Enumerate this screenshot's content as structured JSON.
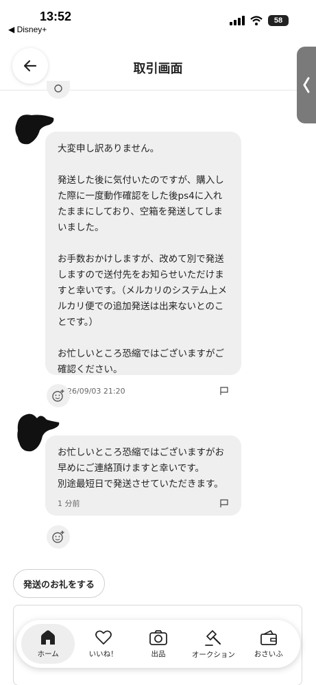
{
  "status_bar": {
    "time": "13:52",
    "back_app": "◀ Disney+",
    "battery": "58"
  },
  "header": {
    "title": "取引画面"
  },
  "messages": [
    {
      "text": "大変申し訳ありません。\n\n発送した後に気付いたのですが、購入した際に一度動作確認をした後ps4に入れたままにしており、空箱を発送してしまいました。\n\nお手数おかけしますが、改めて別で発送しますので送付先をお知らせいただけますと幸いです。（メルカリのシステム上メルカリ便での追加発送は出来ないとのことです。）\n\nお忙しいところ恐縮ではございますがご確認ください。",
      "timestamp": "2026/09/03 21:20"
    },
    {
      "text": "お忙しいところ恐縮ではございますがお早めにご連絡頂けますと幸いです。\n別途最短日で発送させていただきます。",
      "timestamp": "1 分前"
    }
  ],
  "actions": {
    "thanks_label": "発送のお礼をする"
  },
  "nav": [
    {
      "label": "ホーム",
      "icon": "home-icon",
      "active": true
    },
    {
      "label": "いいね！",
      "icon": "heart-icon",
      "active": false
    },
    {
      "label": "出品",
      "icon": "camera-icon",
      "active": false
    },
    {
      "label": "オークション",
      "icon": "gavel-icon",
      "active": false
    },
    {
      "label": "おさいふ",
      "icon": "wallet-icon",
      "active": false
    }
  ],
  "colors": {
    "bubble": "#efefef",
    "text": "#222222",
    "side_tab": "#7a7a7a"
  }
}
